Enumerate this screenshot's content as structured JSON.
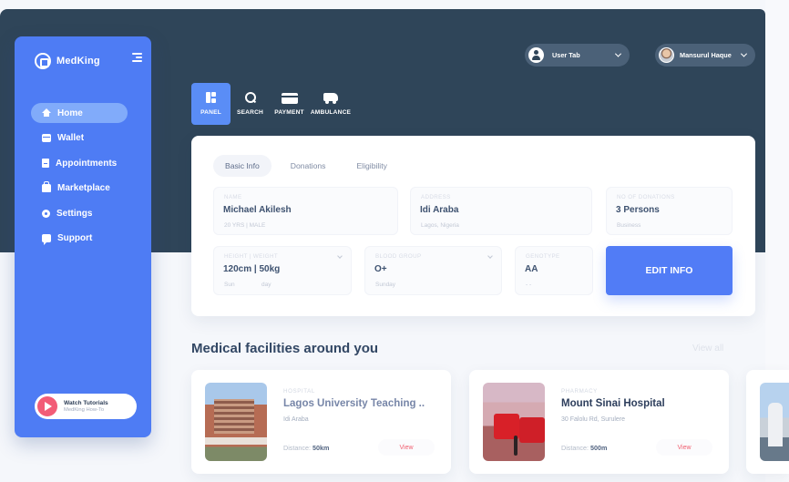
{
  "app": {
    "name": "MedKing"
  },
  "sidebar": {
    "items": [
      {
        "label": "Home",
        "icon": "home-icon",
        "active": true
      },
      {
        "label": "Wallet",
        "icon": "wallet-icon",
        "active": false
      },
      {
        "label": "Appointments",
        "icon": "appointments-icon",
        "active": false
      },
      {
        "label": "Marketplace",
        "icon": "marketplace-icon",
        "active": false
      },
      {
        "label": "Settings",
        "icon": "settings-icon",
        "active": false
      },
      {
        "label": "Support",
        "icon": "support-icon",
        "active": false
      }
    ],
    "tutorial": {
      "title": "Watch Tutorials",
      "subtitle": "MedKing How-To"
    }
  },
  "header": {
    "user_tab_label": "User Tab",
    "profile_name": "Mansurul Haque"
  },
  "tools": [
    {
      "label": "PANEL",
      "icon": "panel-icon",
      "active": true
    },
    {
      "label": "SEARCH",
      "icon": "search-icon",
      "active": false
    },
    {
      "label": "PAYMENT",
      "icon": "payment-icon",
      "active": false
    },
    {
      "label": "AMBULANCE",
      "icon": "ambulance-icon",
      "active": false
    }
  ],
  "info": {
    "tabs": [
      "Basic Info",
      "Donations",
      "Eligibility"
    ],
    "fields": {
      "name": {
        "label": "NAME",
        "value": "Michael Akilesh",
        "sub": "20 YRS | MALE"
      },
      "address": {
        "label": "ADDRESS",
        "value": "Idi Araba",
        "sub": "Lagos, Nigeria"
      },
      "donations": {
        "label": "NO OF DONATIONS",
        "value": "3 Persons",
        "sub": "Business"
      },
      "height_weight": {
        "label": "HEIGHT | WEIGHT",
        "value": "120cm | 50kg",
        "sub_a": "Sun",
        "sub_b": "day"
      },
      "blood_group": {
        "label": "BLOOD GROUP",
        "value": "O+",
        "sub": "Sunday"
      },
      "genotype": {
        "label": "GENOTYPE",
        "value": "AA",
        "sub": "- -"
      }
    },
    "edit_label": "EDIT INFO"
  },
  "facilities": {
    "title": "Medical facilities around you",
    "view_all": "View all",
    "cards": [
      {
        "type": "HOSPITAL",
        "name": "Lagos University Teaching ..",
        "address": "Idi Araba",
        "distance_label": "Distance:",
        "distance": "50km",
        "view_label": "View"
      },
      {
        "type": "PHARMACY",
        "name": "Mount Sinai Hospital",
        "address": "30 Falolu Rd, Surulere",
        "distance_label": "Distance:",
        "distance": "500m",
        "view_label": "View"
      }
    ]
  },
  "colors": {
    "sidebar": "#4e7cf4",
    "header": "#2f4559",
    "accent": "#517cf6",
    "view_button": "#f05f70"
  }
}
